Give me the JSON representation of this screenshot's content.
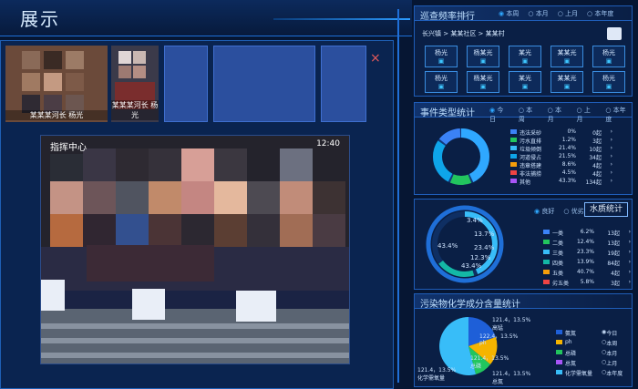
{
  "app": {
    "title": "展示"
  },
  "videos": {
    "thumb1_label": "某某某河长 杨光",
    "thumb2_label": "某某某河长 杨光",
    "main_label": "指挥中心",
    "main_time": "12:40",
    "close_symbol": "×"
  },
  "patrol": {
    "title": "巡查频率排行",
    "tabs": [
      "本周",
      "本月",
      "上月",
      "本年度"
    ],
    "active_tab": 0,
    "breadcrumb": "长兴镇 > 某某社区 > 某某村",
    "cameras": [
      "杨光",
      "杨某光",
      "某光",
      "某某光",
      "杨光",
      "杨光",
      "杨某光",
      "某光",
      "某某光",
      "杨光"
    ]
  },
  "events": {
    "title": "事件类型统计",
    "tabs": [
      "今日",
      "本周",
      "本月",
      "上月",
      "本年度"
    ],
    "active_tab": 0,
    "rows": [
      {
        "name": "违法采砂",
        "pct": "0%",
        "count": "0起",
        "color": "#3b82f6"
      },
      {
        "name": "污水直排",
        "pct": "1.2%",
        "count": "3起",
        "color": "#22c55e"
      },
      {
        "name": "垃圾倾倒",
        "pct": "21.4%",
        "count": "10起",
        "color": "#38bdf8"
      },
      {
        "name": "河道侵占",
        "pct": "21.5%",
        "count": "34起",
        "color": "#0ea5e9"
      },
      {
        "name": "违章搭建",
        "pct": "8.6%",
        "count": "4起",
        "color": "#f59e0b"
      },
      {
        "name": "非法捕捞",
        "pct": "4.5%",
        "count": "4起",
        "color": "#ef4444"
      },
      {
        "name": "其他",
        "pct": "43.3%",
        "count": "134起",
        "color": "#a855f7"
      }
    ]
  },
  "water": {
    "radio": [
      "良好",
      "优劣"
    ],
    "active_radio": 0,
    "button": "水质统计",
    "ring_labels": [
      "3.4%",
      "13.7%",
      "23.4%",
      "12.3%",
      "43.4%",
      "43.4%"
    ],
    "rows": [
      {
        "name": "一类",
        "pct": "6.2%",
        "count": "13起",
        "color": "#3b82f6"
      },
      {
        "name": "二类",
        "pct": "12.4%",
        "count": "13起",
        "color": "#22c55e"
      },
      {
        "name": "三类",
        "pct": "23.3%",
        "count": "19起",
        "color": "#38bdf8"
      },
      {
        "name": "四类",
        "pct": "13.9%",
        "count": "84起",
        "color": "#14b8a6"
      },
      {
        "name": "五类",
        "pct": "40.7%",
        "count": "4起",
        "color": "#f59e0b"
      },
      {
        "name": "劣五类",
        "pct": "5.8%",
        "count": "3起",
        "color": "#ef4444"
      }
    ]
  },
  "pollutants": {
    "title": "污染物化学成分含量统计",
    "pie_labels": [
      {
        "value": "121.4，13.5%",
        "name": "高锰"
      },
      {
        "value": "122.4，13.5%",
        "name": "ph"
      },
      {
        "value": "121.4，13.5%",
        "name": "化学需氧量"
      },
      {
        "value": "121.4，13.5%",
        "name": "总磷"
      },
      {
        "value": "121.4，13.5%",
        "name": "总氮"
      }
    ],
    "legend": [
      "氨氮",
      "ph",
      "总磷",
      "总氮",
      "化学需氧量"
    ],
    "radios": [
      "今日",
      "本周",
      "本月",
      "上月",
      "本年度"
    ],
    "active_radio": 0
  }
}
